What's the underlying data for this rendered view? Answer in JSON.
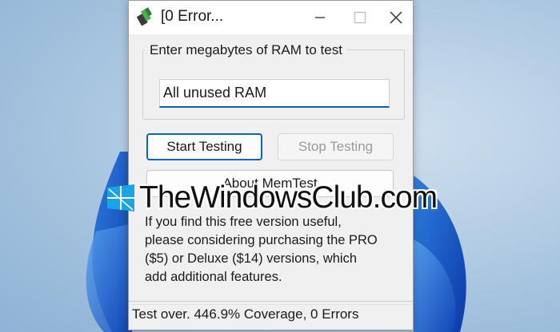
{
  "window": {
    "title": "[0 Error...",
    "minimize_icon": "minimize-icon",
    "maximize_icon": "maximize-icon",
    "close_icon": "close-icon"
  },
  "ram_group": {
    "legend": "Enter megabytes of RAM to test",
    "input_value": "All unused RAM"
  },
  "buttons": {
    "start": "Start Testing",
    "stop": "Stop Testing",
    "about": "About MemTest"
  },
  "info": "If you find this free version useful,\nplease considering purchasing the PRO\n($5) or Deluxe ($14) versions, which\nadd additional features.",
  "status": "Test over. 446.9% Coverage, 0 Errors",
  "watermark": {
    "text": "TheWindowsClub.com",
    "accent": "#1aa3e8"
  },
  "colors": {
    "accent": "#0a64c2",
    "desktop": "#b8d0e6"
  }
}
